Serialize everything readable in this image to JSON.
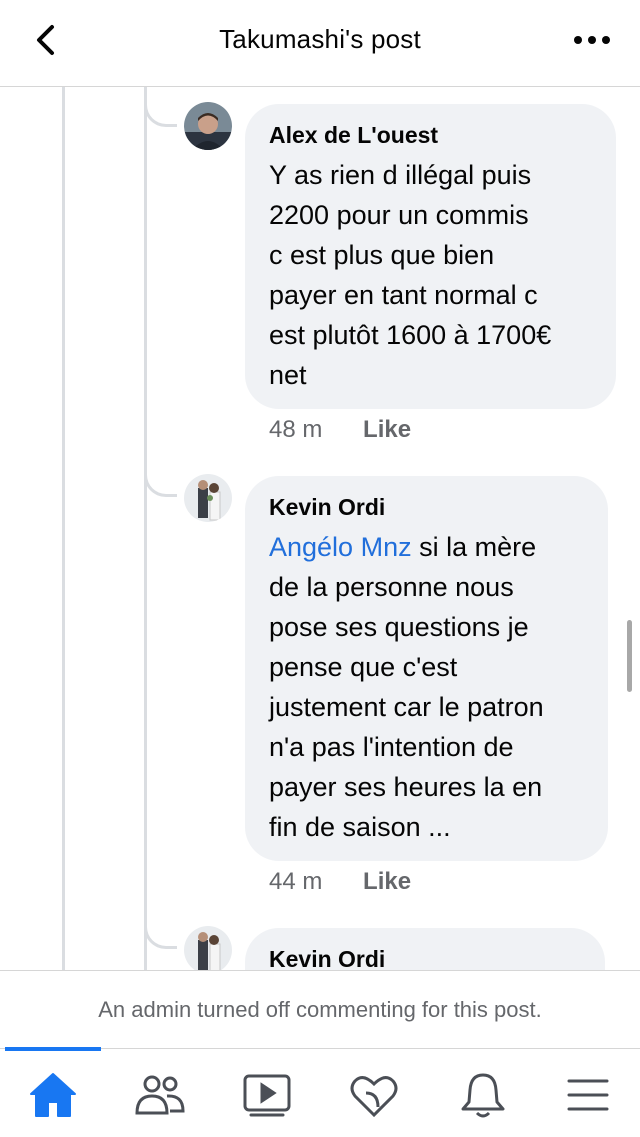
{
  "header": {
    "title": "Takumashi's post"
  },
  "comments": [
    {
      "author": "Alex de L'ouest",
      "text": "Y as rien d illégal puis\n2200 pour un commis\nc est plus que bien\npayer en tant normal c\nest plutôt 1600 à 1700€\nnet",
      "time": "48 m",
      "like": "Like"
    },
    {
      "author": "Kevin Ordi",
      "mention": "Angélo Mnz",
      "text": " si la mère\nde la personne nous\npose ses questions je\npense que c'est\njustement car le patron\nn'a pas l'intention  de\npayer ses heures la en\nfin de saison ...",
      "time": "44 m",
      "like": "Like"
    },
    {
      "author": "Kevin Ordi"
    }
  ],
  "notice": "An admin turned off commenting for this post.",
  "tabbar": {
    "active": "home",
    "tabs": [
      "home-icon",
      "friends-icon",
      "watch-icon",
      "dating-icon",
      "notifications-icon",
      "menu-icon"
    ]
  },
  "colors": {
    "accent": "#1877f2",
    "mention": "#216fdb",
    "bubble": "#f0f2f5",
    "meta": "#65676b"
  }
}
